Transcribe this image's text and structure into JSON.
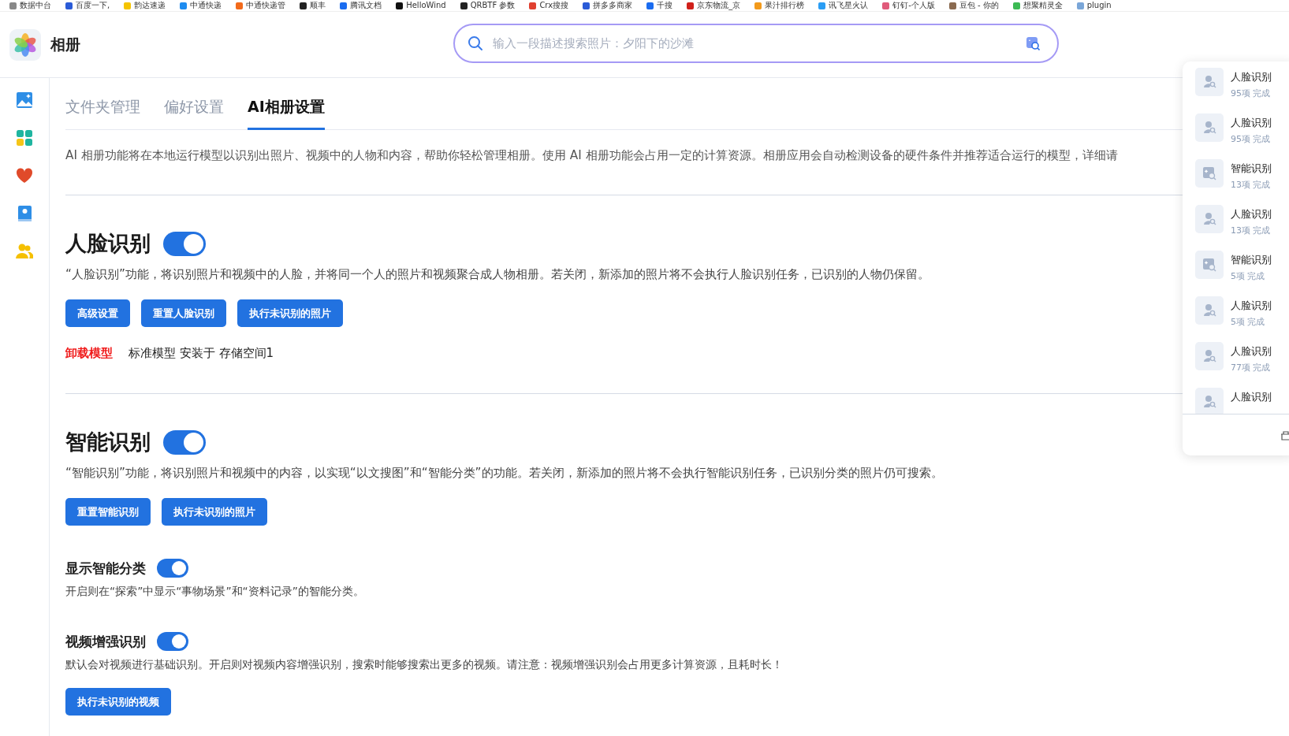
{
  "bookmarks": [
    "数据中台",
    "百度一下,",
    "韵达速递",
    "中通快递",
    "中通快递管",
    "顺丰",
    "腾讯文档",
    "HelloWind",
    "QRBTF 参数",
    "Crx搜搜",
    "拼多多商家",
    "千搜",
    "京东物流_京",
    "果汁排行榜",
    "讯飞星火认",
    "钉钉-个人版",
    "豆包 - 你的",
    "想聚精灵全",
    "plugin"
  ],
  "app": {
    "title": "相册"
  },
  "search": {
    "placeholder": "输入一段描述搜索照片：夕阳下的沙滩"
  },
  "tabs": [
    {
      "label": "文件夹管理",
      "selected": false
    },
    {
      "label": "偏好设置",
      "selected": false
    },
    {
      "label": "AI相册设置",
      "selected": true
    }
  ],
  "intro": "AI 相册功能将在本地运行模型以识别出照片、视频中的人物和内容，帮助你轻松管理相册。使用 AI 相册功能会占用一定的计算资源。相册应用会自动检测设备的硬件条件并推荐适合运行的模型，详细请",
  "sections": [
    {
      "title": "人脸识别",
      "on": true,
      "description": "“人脸识别”功能，将识别照片和视频中的人脸，并将同一个人的照片和视频聚合成人物相册。若关闭，新添加的照片将不会执行人脸识别任务，已识别的人物仍保留。",
      "buttons": [
        "高级设置",
        "重置人脸识别",
        "执行未识别的照片"
      ],
      "model": {
        "action": "卸载模型",
        "info": "标准模型 安装于 存储空间1"
      }
    },
    {
      "title": "智能识别",
      "on": true,
      "description": "“智能识别”功能，将识别照片和视频中的内容，以实现“以文搜图”和“智能分类”的功能。若关闭，新添加的照片将不会执行智能识别任务，已识别分类的照片仍可搜索。",
      "buttons": [
        "重置智能识别",
        "执行未识别的照片"
      ],
      "options": [
        {
          "title": "显示智能分类",
          "on": true,
          "description": "开启则在“探索”中显示“事物场景”和“资料记录”的智能分类。"
        },
        {
          "title": "视频增强识别",
          "on": true,
          "description": "默认会对视频进行基础识别。开启则对视频内容增强识别，搜索时能够搜索出更多的视频。请注意：视频增强识别会占用更多计算资源，且耗时长！",
          "buttons": [
            "执行未识别的视频"
          ]
        }
      ]
    }
  ],
  "task_panel": {
    "items": [
      {
        "kind": "face",
        "title": "人脸识别",
        "count": "95项 完成"
      },
      {
        "kind": "face",
        "title": "人脸识别",
        "count": "95项 完成"
      },
      {
        "kind": "smart",
        "title": "智能识别",
        "count": "13项 完成"
      },
      {
        "kind": "face",
        "title": "人脸识别",
        "count": "13项 完成"
      },
      {
        "kind": "smart",
        "title": "智能识别",
        "count": "5项 完成"
      },
      {
        "kind": "face",
        "title": "人脸识别",
        "count": "5项 完成"
      },
      {
        "kind": "face",
        "title": "人脸识别",
        "count": "77项 完成"
      },
      {
        "kind": "face",
        "title": "人脸识别"
      }
    ]
  }
}
